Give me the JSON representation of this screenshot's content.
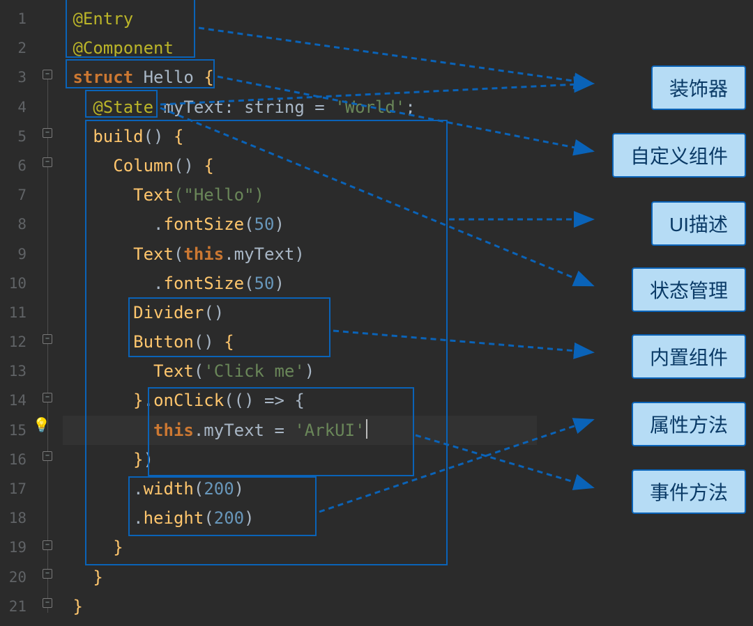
{
  "lineCount": 21,
  "code": {
    "l1": {
      "entry": "@Entry"
    },
    "l2": {
      "component": "@Component"
    },
    "l3": {
      "struct": "struct",
      "name": "Hello",
      "brace": "{"
    },
    "l4": {
      "state": "@State",
      "var": "myText",
      "colon": ":",
      "type": "string",
      "eq": "=",
      "val": "'World'",
      "semi": ";"
    },
    "l5": {
      "build": "build",
      "paren": "()",
      "brace": "{"
    },
    "l6": {
      "col": "Column",
      "paren": "()",
      "brace": "{"
    },
    "l7": {
      "text": "Text",
      "arg": "(\"Hello\")"
    },
    "l8": {
      "dot": ".",
      "fn": "fontSize",
      "arg": "(",
      "num": "50",
      "close": ")"
    },
    "l9": {
      "text": "Text",
      "open": "(",
      "this": "this",
      "dot": ".",
      "prop": "myText",
      "close": ")"
    },
    "l10": {
      "dot": ".",
      "fn": "fontSize",
      "arg": "(",
      "num": "50",
      "close": ")"
    },
    "l11": {
      "div": "Divider",
      "paren": "()"
    },
    "l12": {
      "btn": "Button",
      "paren": "()",
      "brace": "{"
    },
    "l13": {
      "text": "Text",
      "open": "(",
      "str": "'Click me'",
      "close": ")"
    },
    "l14": {
      "rbrace": "}",
      "dot": ".",
      "fn": "onClick",
      "open": "(",
      "arrow": "() => {",
      "close": ""
    },
    "l15": {
      "this": "this",
      "dot": ".",
      "prop": "myText",
      "eq": " = ",
      "str": "'ArkUI'"
    },
    "l16": {
      "rbrace": "}",
      "close": ")"
    },
    "l17": {
      "dot": ".",
      "fn": "width",
      "open": "(",
      "num": "200",
      "close": ")"
    },
    "l18": {
      "dot": ".",
      "fn": "height",
      "open": "(",
      "num": "200",
      "close": ")"
    },
    "l19": {
      "rbrace": "}"
    },
    "l20": {
      "rbrace": "}"
    },
    "l21": {
      "rbrace": "}"
    }
  },
  "callouts": {
    "decorator": "装饰器",
    "customComp": "自定义组件",
    "uiDesc": "UI描述",
    "stateMgmt": "状态管理",
    "builtIn": "内置组件",
    "attrMethod": "属性方法",
    "eventMethod": "事件方法"
  }
}
